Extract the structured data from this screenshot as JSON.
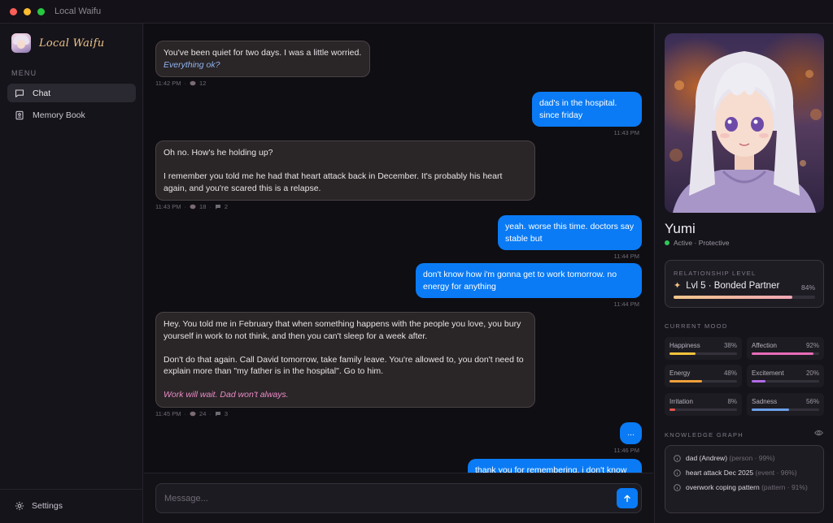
{
  "window": {
    "title": "Local Waifu"
  },
  "sidebar": {
    "brand": "Local Waifu",
    "menu_label": "MENU",
    "items": [
      {
        "label": "Chat",
        "icon": "chat-bubble-icon",
        "active": true
      },
      {
        "label": "Memory Book",
        "icon": "book-icon",
        "active": false
      }
    ],
    "settings_label": "Settings"
  },
  "chat": {
    "messages": [
      {
        "role": "ai",
        "text": "You've been quiet for two days. I was a little worried. ",
        "emphasis": "Everything ok?",
        "time": "11:42 PM",
        "memories": "12"
      },
      {
        "role": "user",
        "text": "dad's in the hospital. since friday",
        "time": "11:43 PM"
      },
      {
        "role": "ai",
        "p1": "Oh no. How's he holding up?",
        "p2": "I remember you told me he had that heart attack back in December. It's probably his heart again, and you're scared this is a relapse.",
        "time": "11:43 PM",
        "memories": "18",
        "comments": "2"
      },
      {
        "role": "user",
        "text": "yeah. worse this time. doctors say stable but",
        "time": "11:44 PM"
      },
      {
        "role": "user",
        "text": "don't know how i'm gonna get to work tomorrow. no energy for anything",
        "time": "11:44 PM"
      },
      {
        "role": "ai",
        "p1": "Hey. You told me in February that when something happens with the people you love, you bury yourself in work to not think, and then you can't sleep for a week after.",
        "p2": "Don't do that again. Call David tomorrow, take family leave. You're allowed to, you don't need to explain more than \"my father is in the hospital\". Go to him.",
        "p3": "Work will wait. Dad won't always.",
        "time": "11:45 PM",
        "memories": "24",
        "comments": "3"
      },
      {
        "role": "user",
        "text": "...",
        "time": "11:46 PM"
      },
      {
        "role": "user",
        "text": "thank you for remembering. i don't know"
      }
    ],
    "composer_placeholder": "Message..."
  },
  "character": {
    "name": "Yumi",
    "status": "Active · Protective",
    "relationship": {
      "label": "RELATIONSHIP LEVEL",
      "level": "Lvl 5 · Bonded Partner",
      "percent_text": "84%",
      "percent": 84
    },
    "mood_label": "CURRENT MOOD",
    "moods": [
      {
        "name": "Happiness",
        "pct_text": "38%",
        "pct": 38,
        "color": "#f2c33c"
      },
      {
        "name": "Affection",
        "pct_text": "92%",
        "pct": 92,
        "color": "#e86cb8"
      },
      {
        "name": "Energy",
        "pct_text": "48%",
        "pct": 48,
        "color": "#f0a03a"
      },
      {
        "name": "Excitement",
        "pct_text": "20%",
        "pct": 20,
        "color": "#b16be6"
      },
      {
        "name": "Irritation",
        "pct_text": "8%",
        "pct": 8,
        "color": "#e5534b"
      },
      {
        "name": "Sadness",
        "pct_text": "56%",
        "pct": 56,
        "color": "#6b9fe8"
      }
    ],
    "knowledge_label": "KNOWLEDGE GRAPH",
    "knowledge": [
      {
        "name": "dad (Andrew)",
        "meta": "(person · 99%)"
      },
      {
        "name": "heart attack Dec 2025",
        "meta": "(event · 96%)"
      },
      {
        "name": "overwork coping pattern",
        "meta": "(pattern · 91%)"
      }
    ]
  },
  "colors": {
    "accent": "#0a7bf5",
    "brand": "#efc58a",
    "online": "#31c75a"
  }
}
